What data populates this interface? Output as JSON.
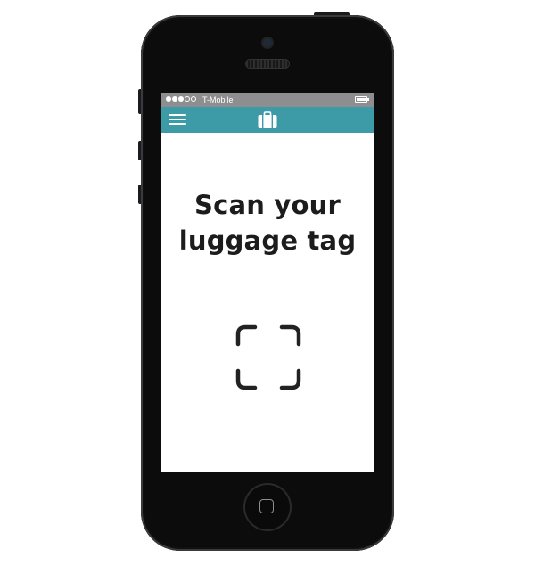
{
  "status_bar": {
    "signal_dots": [
      "full",
      "full",
      "full",
      "empty",
      "empty"
    ],
    "carrier": "T-Mobile",
    "battery_icon": "battery-icon"
  },
  "nav_bar": {
    "background_color": "#3d9ba8",
    "menu_icon": "hamburger-menu-icon",
    "logo_icon": "suitcase-icon"
  },
  "main": {
    "headline_line1": "Scan your",
    "headline_line2": "luggage tag",
    "scan_icon": "scan-frame-icon"
  },
  "device": {
    "home_button_icon": "home-button-icon"
  }
}
